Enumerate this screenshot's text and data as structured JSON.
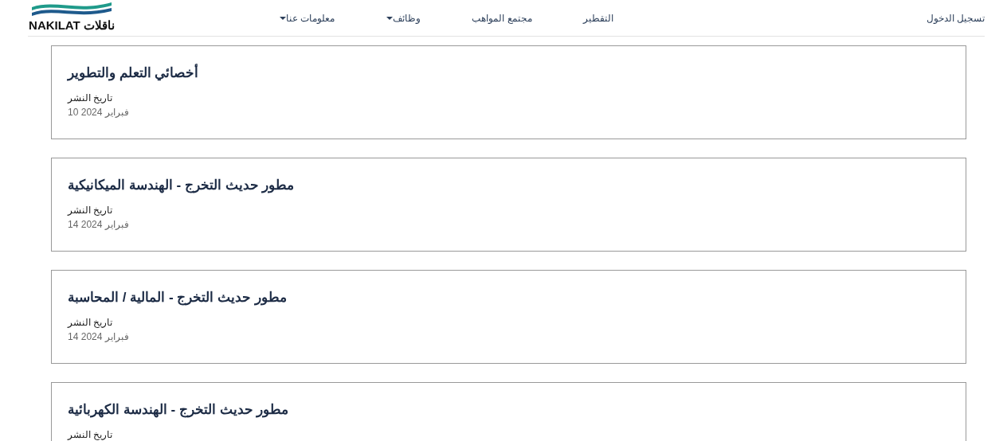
{
  "logo": {
    "latin": "NAKILAT",
    "arabic": "ناقلات"
  },
  "nav": [
    {
      "label": "التقطير",
      "dropdown": false
    },
    {
      "label": "مجتمع المواهب",
      "dropdown": false
    },
    {
      "label": "وظائف",
      "dropdown": true
    },
    {
      "label": "معلومات عنا",
      "dropdown": true
    }
  ],
  "login": "تسجيل الدخول",
  "jobs": [
    {
      "title": "أخصائي التعلم والتطوير",
      "date_label": "تاريخ النشر",
      "date": "فبراير 2024 10"
    },
    {
      "title": "مطور حديث التخرج - الهندسة الميكانيكية",
      "date_label": "تاريخ النشر",
      "date": "فبراير 2024 14"
    },
    {
      "title": "مطور حديث التخرج - المالية / المحاسبة",
      "date_label": "تاريخ النشر",
      "date": "فبراير 2024 14"
    },
    {
      "title": "مطور حديث التخرج - الهندسة الكهربائية",
      "date_label": "تاريخ النشر"
    }
  ]
}
